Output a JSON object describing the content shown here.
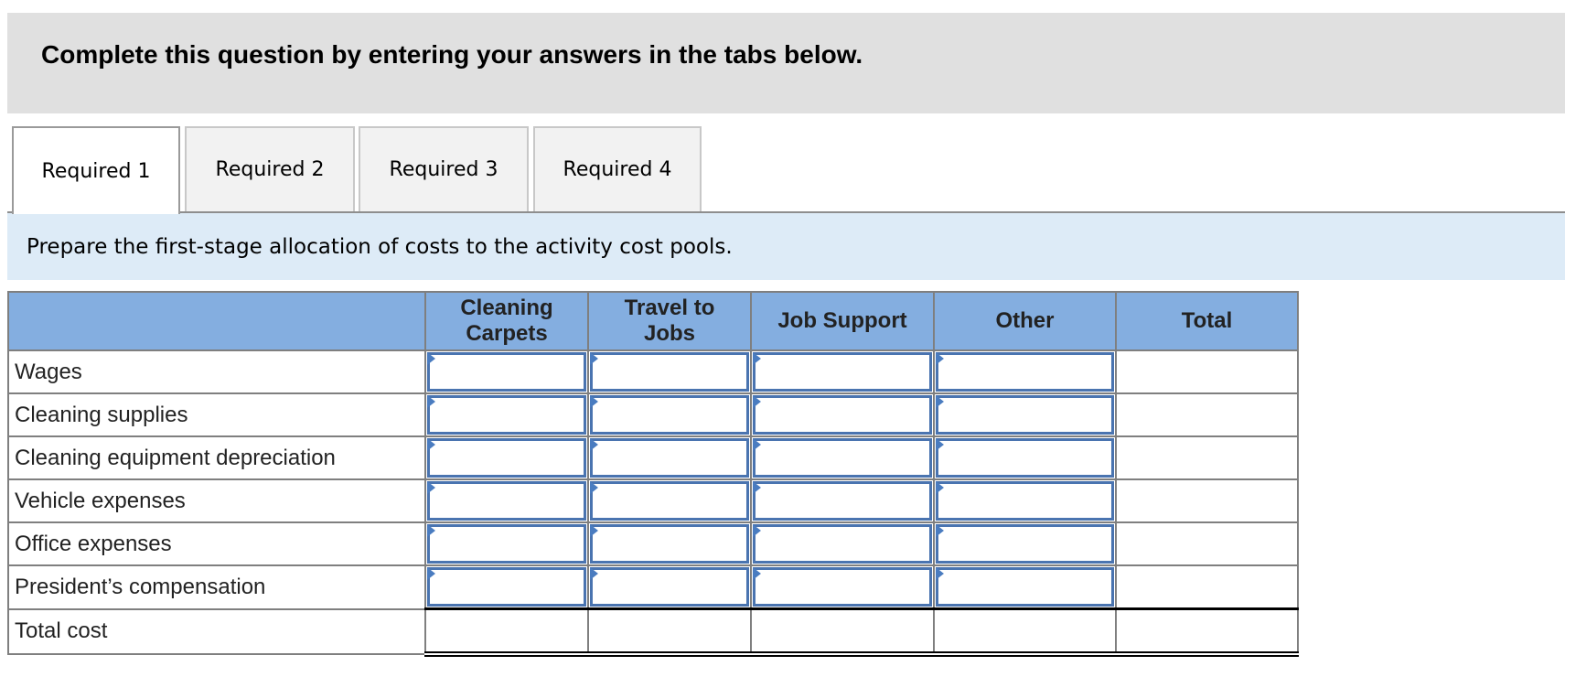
{
  "banner": {
    "title": "Complete this question by entering your answers in the tabs below."
  },
  "tabs": [
    {
      "label": "Required 1",
      "active": true
    },
    {
      "label": "Required 2",
      "active": false
    },
    {
      "label": "Required 3",
      "active": false
    },
    {
      "label": "Required 4",
      "active": false
    }
  ],
  "instruction": "Prepare the first-stage allocation of costs to the activity cost pools.",
  "table": {
    "columns": [
      "",
      "Cleaning Carpets",
      "Travel to Jobs",
      "Job Support",
      "Other",
      "Total"
    ],
    "rows": [
      {
        "label": "Wages",
        "values": [
          "",
          "",
          "",
          ""
        ],
        "total": ""
      },
      {
        "label": "Cleaning supplies",
        "values": [
          "",
          "",
          "",
          ""
        ],
        "total": ""
      },
      {
        "label": "Cleaning equipment depreciation",
        "values": [
          "",
          "",
          "",
          ""
        ],
        "total": ""
      },
      {
        "label": "Vehicle expenses",
        "values": [
          "",
          "",
          "",
          ""
        ],
        "total": ""
      },
      {
        "label": "Office expenses",
        "values": [
          "",
          "",
          "",
          ""
        ],
        "total": ""
      },
      {
        "label": "President’s compensation",
        "values": [
          "",
          "",
          "",
          ""
        ],
        "total": ""
      }
    ],
    "total_row": {
      "label": "Total cost",
      "values": [
        "",
        "",
        "",
        "",
        ""
      ]
    }
  },
  "colors": {
    "banner_bg": "#e0e0e0",
    "instruction_bg": "#ddebf7",
    "header_bg": "#84aee0",
    "input_border": "#4a74b0"
  }
}
